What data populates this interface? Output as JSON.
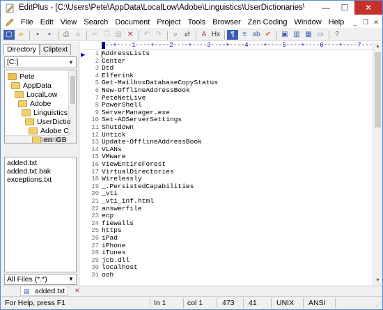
{
  "window": {
    "title": "EditPlus - [C:\\Users\\Pete\\AppData\\LocalLow\\Adobe\\Linguistics\\UserDictionaries\\Adobe Cus...",
    "minimize_glyph": "—",
    "maximize_glyph": "☐",
    "close_glyph": "✕"
  },
  "menu": {
    "items": [
      "File",
      "Edit",
      "View",
      "Search",
      "Document",
      "Project",
      "Tools",
      "Browser",
      "Zen Coding",
      "Window",
      "Help"
    ],
    "mdi_minimize": "_",
    "mdi_restore": "❐",
    "mdi_close": "✕"
  },
  "toolbar": {
    "buttons": [
      {
        "icon": "new-file-icon",
        "glyph": "▢",
        "color": "#ffffff"
      },
      {
        "icon": "open-folder-icon",
        "glyph": "▰",
        "color": "#e8c15a"
      },
      {
        "icon": "save-icon",
        "glyph": "▪",
        "color": "#3a5fb0"
      },
      {
        "icon": "save-all-icon",
        "glyph": "▪",
        "color": "#3a5fb0"
      },
      {
        "icon": "print-icon",
        "glyph": "⎙",
        "color": "#555555"
      },
      {
        "icon": "print-preview-icon",
        "glyph": "⌕",
        "color": "#555555"
      },
      {
        "icon": "cut-icon",
        "glyph": "✂",
        "color": "#b0b0b0"
      },
      {
        "icon": "copy-icon",
        "glyph": "❐",
        "color": "#b0b0b0"
      },
      {
        "icon": "paste-icon",
        "glyph": "▤",
        "color": "#b0b0b0"
      },
      {
        "icon": "delete-icon",
        "glyph": "✕",
        "color": "#c03030"
      },
      {
        "icon": "undo-icon",
        "glyph": "↶",
        "color": "#b0b0b0"
      },
      {
        "icon": "redo-icon",
        "glyph": "↷",
        "color": "#b0b0b0"
      },
      {
        "icon": "find-icon",
        "glyph": "⌕",
        "color": "#555555"
      },
      {
        "icon": "replace-icon",
        "glyph": "⇄",
        "color": "#555555"
      },
      {
        "icon": "font-icon",
        "glyph": "A",
        "color": "#c03030"
      },
      {
        "icon": "heading-icon",
        "glyph": "Hx",
        "color": "#333333"
      },
      {
        "icon": "word-wrap-icon",
        "glyph": "¶",
        "color": "#ffffff"
      },
      {
        "icon": "line-number-icon",
        "glyph": "≡",
        "color": "#3a5fb0"
      },
      {
        "icon": "spellcheck-icon",
        "glyph": "ab",
        "color": "#3a5fb0"
      },
      {
        "icon": "check-icon",
        "glyph": "✔",
        "color": "#e06020"
      },
      {
        "icon": "fullscreen-icon",
        "glyph": "▣",
        "color": "#3a5fb0"
      },
      {
        "icon": "directory-window-icon",
        "glyph": "▥",
        "color": "#3a5fb0"
      },
      {
        "icon": "cliptext-window-icon",
        "glyph": "▦",
        "color": "#3a5fb0"
      },
      {
        "icon": "output-window-icon",
        "glyph": "▭",
        "color": "#3a5fb0"
      },
      {
        "icon": "help-icon",
        "glyph": "?",
        "color": "#3a5fb0"
      }
    ]
  },
  "sidebar": {
    "tabs": [
      "Directory",
      "Cliptext"
    ],
    "drive": "[C:]",
    "drive_arrow": "▼",
    "tree": [
      {
        "label": "Pete",
        "level": 1
      },
      {
        "label": "AppData",
        "level": 2
      },
      {
        "label": "LocalLow",
        "level": 3
      },
      {
        "label": "Adobe",
        "level": 4
      },
      {
        "label": "Linguistics",
        "level": 5
      },
      {
        "label": "UserDictio",
        "level": 6
      },
      {
        "label": "Adobe C",
        "level": 7
      },
      {
        "label": "en_GB",
        "level": 8
      }
    ],
    "files": [
      "added.txt",
      "added.txt.bak",
      "exceptions.txt"
    ],
    "filter": "All Files (*.*)",
    "filter_arrow": "▼"
  },
  "editor": {
    "ruler": "---+----1----+----2----+----3----+----4----+----5----+----6----+----7---",
    "current_line_marker": "▶",
    "lines": [
      "AddressLists",
      "Center",
      "Dtd",
      "Elferink",
      "Get-MailboxDatabaseCopyStatus",
      "New-OfflineAddressBook",
      "PeteNetLive",
      "PowerShell",
      "ServerManager.exe",
      "Set-ADServerSettings",
      "Shutdown",
      "Untick",
      "Update-OfflineAddressBook",
      "VLANs",
      "VMware",
      "ViewEntireForest",
      "VirtualDirectories",
      "Wirelessly",
      "_.PersistedCapabilities",
      "_vti",
      "_vti_inf.html",
      "answerfile",
      "ecp",
      "fiewalls",
      "https",
      "iPad",
      "iPhone",
      "iTunes",
      "jcb.dll",
      "localhost",
      "ooh"
    ],
    "scroll_up": "▲",
    "scroll_down": "▼"
  },
  "doc_tabs": {
    "active": "added.txt",
    "close_glyph": "✕",
    "file_glyph": "▤"
  },
  "status": {
    "help": "For Help, press F1",
    "line": "In 1",
    "col": "col 1",
    "chars": "473",
    "lines": "41",
    "format": "UNIX",
    "encoding": "ANSI",
    "grip": "⋰"
  }
}
